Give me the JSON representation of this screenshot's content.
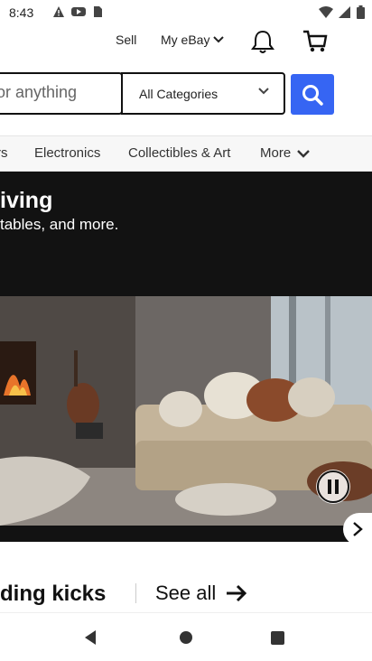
{
  "status_bar": {
    "time": "8:43",
    "icons": [
      "alert-icon",
      "media-icon",
      "sim-icon",
      "wifi-icon",
      "signal-icon",
      "battery-icon"
    ]
  },
  "header": {
    "sell_label": "Sell",
    "my_ebay_label": "My eBay"
  },
  "search": {
    "placeholder_visible": "or anything",
    "category": "All Categories"
  },
  "tabs": [
    {
      "label": "rs"
    },
    {
      "label": "Electronics"
    },
    {
      "label": "Collectibles & Art"
    },
    {
      "label": "More"
    }
  ],
  "hero": {
    "title": "iving",
    "subtitle": "tables, and more."
  },
  "section": {
    "title": "ding kicks",
    "see_all_label": "See all"
  },
  "colors": {
    "accent": "#3665f3",
    "hero_bg": "#121212"
  }
}
